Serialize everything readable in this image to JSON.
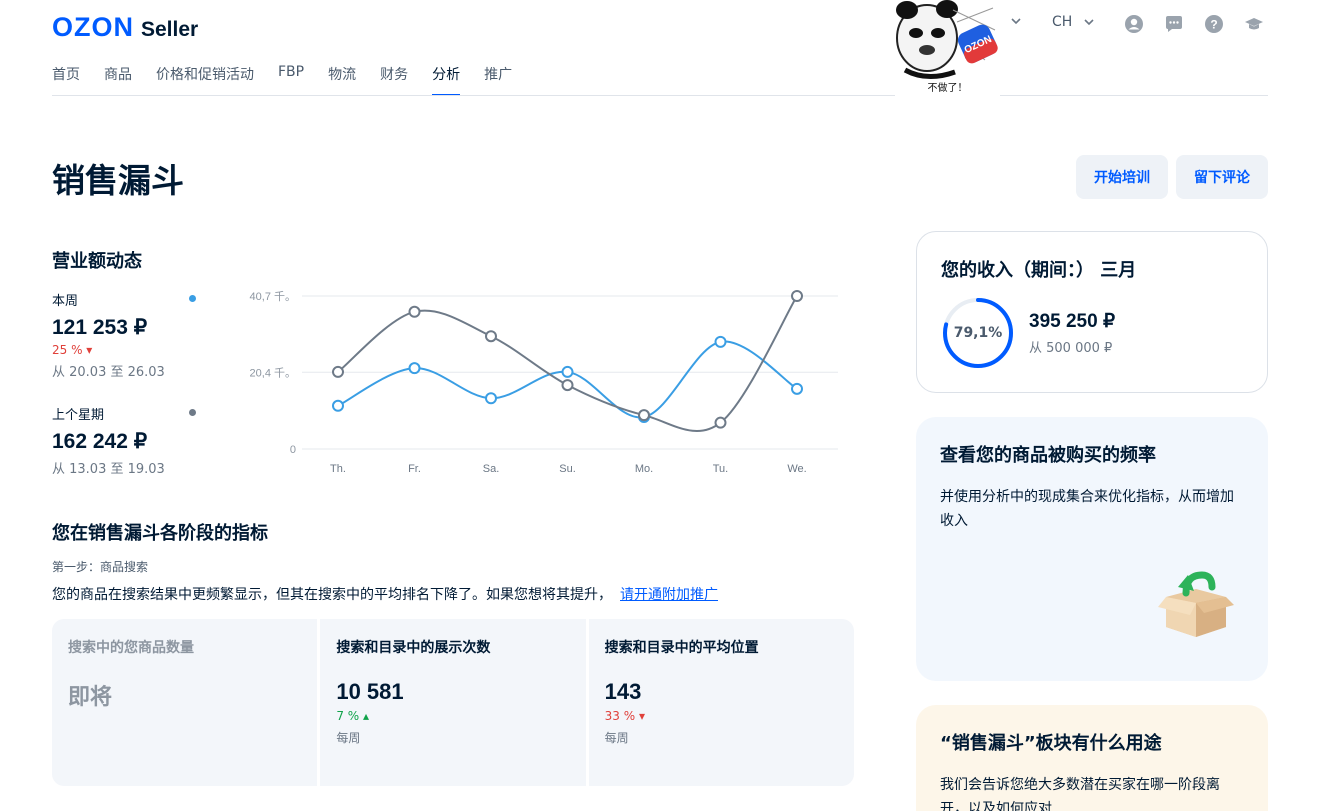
{
  "header": {
    "logo_brand": "OZON",
    "logo_product": "Seller",
    "lang": "CH",
    "nav": [
      "首页",
      "商品",
      "价格和促销活动",
      "FBP",
      "物流",
      "财务",
      "分析",
      "推广"
    ],
    "active_nav": "分析",
    "meme_caption": "不做了！",
    "icons": [
      "user-icon",
      "chat-icon",
      "help-icon",
      "education-icon"
    ]
  },
  "page": {
    "title": "销售漏斗",
    "btn_train": "开始培训",
    "btn_review": "留下评论"
  },
  "revenue": {
    "title": "营业额动态",
    "this_week": {
      "label": "本周",
      "value": "121 253 ₽",
      "change": "25 % ▾",
      "range": "从 20.03 至 26.03",
      "color": "#3a9ee4"
    },
    "last_week": {
      "label": "上个星期",
      "value": "162 242 ₽",
      "range": "从 13.03 至 19.03",
      "color": "#6e7a88"
    }
  },
  "chart_data": {
    "type": "line",
    "categories": [
      "Th.",
      "Fr.",
      "Sa.",
      "Su.",
      "Mo.",
      "Tu.",
      "We."
    ],
    "y_ticks": [
      {
        "value": 0,
        "label": "0"
      },
      {
        "value": 20.4,
        "label": "20,4 千。"
      },
      {
        "value": 40.7,
        "label": "40,7 千。"
      }
    ],
    "ylim": [
      0,
      40.7
    ],
    "series": [
      {
        "values": [
          11.5,
          21.5,
          13.5,
          20.5,
          8.5,
          28.5,
          16
        ],
        "color": "#3a9ee4"
      },
      {
        "values": [
          20.5,
          36.5,
          30,
          17,
          9,
          7,
          40.7
        ],
        "color": "#6e7a88"
      }
    ]
  },
  "funnel": {
    "title": "您在销售漏斗各阶段的指标",
    "step": "第一步：商品搜索",
    "desc": "您的商品在搜索结果中更频繁显示，但其在搜索中的平均排名下降了。如果您想将其提升，",
    "link": "请开通附加推广",
    "metrics": [
      {
        "label": "搜索中的您商品数量",
        "value": "即将",
        "change": "",
        "period": ""
      },
      {
        "label": "搜索和目录中的展示次数",
        "value": "10 581",
        "change": "7 % ▴",
        "period": "每周"
      },
      {
        "label": "搜索和目录中的平均位置",
        "value": "143",
        "change": "33 % ▾",
        "period": "每周"
      }
    ]
  },
  "income": {
    "title": "您的收入（期间：） 三月",
    "percent_label": "79,1%",
    "percent": 0.791,
    "value": "395 250 ₽",
    "from": "从 500 000 ₽"
  },
  "promo": {
    "title": "查看您的商品被购买的频率",
    "text": "并使用分析中的现成集合来优化指标，从而增加收入"
  },
  "info": {
    "title": "“销售漏斗”板块有什么用途",
    "text": "我们会告诉您绝大多数潜在买家在哪一阶段离开，以及如何应对"
  }
}
